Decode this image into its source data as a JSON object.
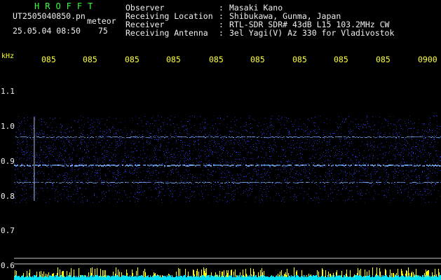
{
  "header": {
    "brand": "HROFFT",
    "filename": "UT2505040850.pn",
    "mode": "meteor",
    "datetime": "25.05.04 08:50",
    "count": "75",
    "info": [
      {
        "label": "Observer",
        "value": "Masaki Kano"
      },
      {
        "label": "Receiving Location",
        "value": "Shibukawa, Gunma, Japan"
      },
      {
        "label": "Receiver",
        "value": "RTL-SDR SDR# 43dB L15 103.2MHz CW"
      },
      {
        "label": "Receiving Antenna",
        "value": "3el Yagi(V) Az 330 for Vladivostok"
      }
    ]
  },
  "axes": {
    "y_unit": "kHz",
    "y_ticks": [
      "1.1",
      "1.0",
      "0.9",
      "0.8",
      "0.7",
      "0.6"
    ],
    "x_ticks": [
      "085",
      "085",
      "085",
      "085",
      "085",
      "085",
      "085",
      "085",
      "085",
      "0900"
    ]
  },
  "spectrogram": {
    "signal_lines_khz": [
      0.97,
      0.89,
      0.84
    ],
    "colors": {
      "background": "#000000",
      "noise": "#2a3cff",
      "signal": "#78b4ff",
      "meteor_trace": "#ccddff",
      "baseline": "#c8c8c8",
      "level_bar": "#00e5ff",
      "level_peak": "#ffff00"
    }
  }
}
